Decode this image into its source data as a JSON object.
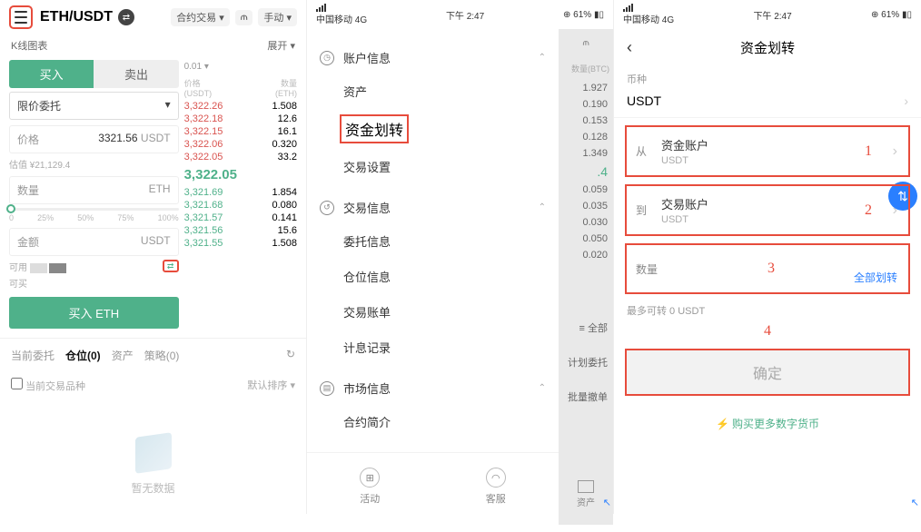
{
  "c1": {
    "pair": "ETH/USDT",
    "chip_contract": "合约交易 ▾",
    "chip_manual": "手动 ▾",
    "kline_label": "K线图表",
    "kline_expand": "展开 ▾",
    "tab_buy": "买入",
    "tab_sell": "卖出",
    "order_type": "限价委托",
    "price_label": "价格",
    "price_val": "3321.56",
    "price_unit": "USDT",
    "est_label": "估值 ¥21,129.4",
    "qty_label": "数量",
    "qty_unit": "ETH",
    "slider": [
      "0",
      "25%",
      "50%",
      "75%",
      "100%"
    ],
    "amt_label": "金额",
    "amt_unit": "USDT",
    "avail_label": "可用",
    "buyable_label": "可买",
    "buy_btn": "买入 ETH",
    "book_tick": "0.01 ▾",
    "book_hdr_price": "价格",
    "book_hdr_price_unit": "(USDT)",
    "book_hdr_qty": "数量",
    "book_hdr_qty_unit": "(ETH)",
    "asks": [
      [
        "3,322.26",
        "1.508"
      ],
      [
        "3,322.18",
        "12.6"
      ],
      [
        "3,322.15",
        "16.1"
      ],
      [
        "3,322.06",
        "0.320"
      ],
      [
        "3,322.05",
        "33.2"
      ]
    ],
    "mid": "3,322.05",
    "bids": [
      [
        "3,321.69",
        "1.854"
      ],
      [
        "3,321.68",
        "0.080"
      ],
      [
        "3,321.57",
        "0.141"
      ],
      [
        "3,321.56",
        "15.6"
      ],
      [
        "3,321.55",
        "1.508"
      ]
    ],
    "pos_tabs": [
      "当前委托",
      "仓位(0)",
      "资产",
      "策略(0)"
    ],
    "chk_label": "当前交易品种",
    "sort_label": "默认排序 ▾",
    "empty": "暂无数据"
  },
  "c2": {
    "status_carrier": "中国移动  4G",
    "status_time": "下午 2:47",
    "status_batt": "61%",
    "sec1_title": "账户信息",
    "sec1_items": [
      "资产",
      "资金划转",
      "交易设置"
    ],
    "sec2_title": "交易信息",
    "sec2_items": [
      "委托信息",
      "仓位信息",
      "交易账单",
      "计息记录"
    ],
    "sec3_title": "市场信息",
    "sec3_items": [
      "合约简介"
    ],
    "btm_activity": "活动",
    "btm_service": "客服",
    "right_hdr": "数量(BTC)",
    "right_vals_a": [
      "1.927",
      "0.190",
      "0.153",
      "0.128",
      "1.349"
    ],
    "right_mid": ".4",
    "right_vals_b": [
      "0.059",
      "0.035",
      "0.030",
      "0.050",
      "0.020"
    ],
    "right_all": "≡ 全部",
    "right_plan": "计划委托",
    "right_batch": "批量撤单",
    "right_assets": "资产"
  },
  "c3": {
    "status_carrier": "中国移动  4G",
    "status_time": "下午 2:47",
    "status_batt": "61%",
    "title": "资金划转",
    "coin_label": "币种",
    "coin_val": "USDT",
    "from_k": "从",
    "from_v": "资金账户",
    "from_sub": "USDT",
    "to_k": "到",
    "to_v": "交易账户",
    "to_sub": "USDT",
    "qty_k": "数量",
    "all_btn": "全部划转",
    "max_label": "最多可转  0 USDT",
    "confirm": "确定",
    "more": "购买更多数字货币",
    "n1": "1",
    "n2": "2",
    "n3": "3",
    "n4": "4"
  }
}
